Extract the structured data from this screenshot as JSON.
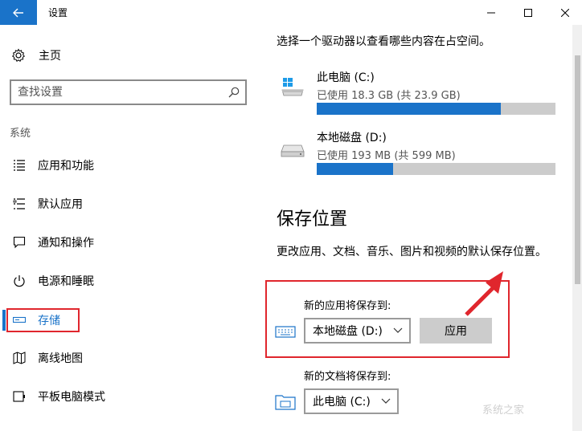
{
  "window": {
    "title": "设置"
  },
  "sidebar": {
    "home_label": "主页",
    "search_placeholder": "查找设置",
    "section_label": "系统",
    "items": [
      {
        "label": "应用和功能",
        "icon": "list-icon"
      },
      {
        "label": "默认应用",
        "icon": "default-apps-icon"
      },
      {
        "label": "通知和操作",
        "icon": "notification-icon"
      },
      {
        "label": "电源和睡眠",
        "icon": "power-icon"
      },
      {
        "label": "存储",
        "icon": "storage-icon",
        "active": true
      },
      {
        "label": "离线地图",
        "icon": "map-icon"
      },
      {
        "label": "平板电脑模式",
        "icon": "tablet-icon"
      }
    ]
  },
  "main": {
    "intro": "选择一个驱动器以查看哪些内容在占空间。",
    "drives": [
      {
        "name": "此电脑 (C:)",
        "usage": "已使用 18.3 GB (共 23.9 GB)",
        "used_fraction": 0.77,
        "icon": "windows-drive-icon"
      },
      {
        "name": "本地磁盘 (D:)",
        "usage": "已使用 193 MB (共 599 MB)",
        "used_fraction": 0.32,
        "icon": "hard-drive-icon"
      }
    ],
    "heading": "保存位置",
    "description": "更改应用、文档、音乐、图片和视频的默认保存位置。",
    "save_apps_label": "新的应用将保存到:",
    "save_apps_value": "本地磁盘 (D:)",
    "apply_label": "应用",
    "save_docs_label": "新的文档将保存到:",
    "save_docs_value": "此电脑 (C:)"
  },
  "watermark": "系统之家",
  "colors": {
    "accent": "#1a73c9",
    "highlight_box": "#e0262d",
    "bar_track": "#cccccc"
  }
}
